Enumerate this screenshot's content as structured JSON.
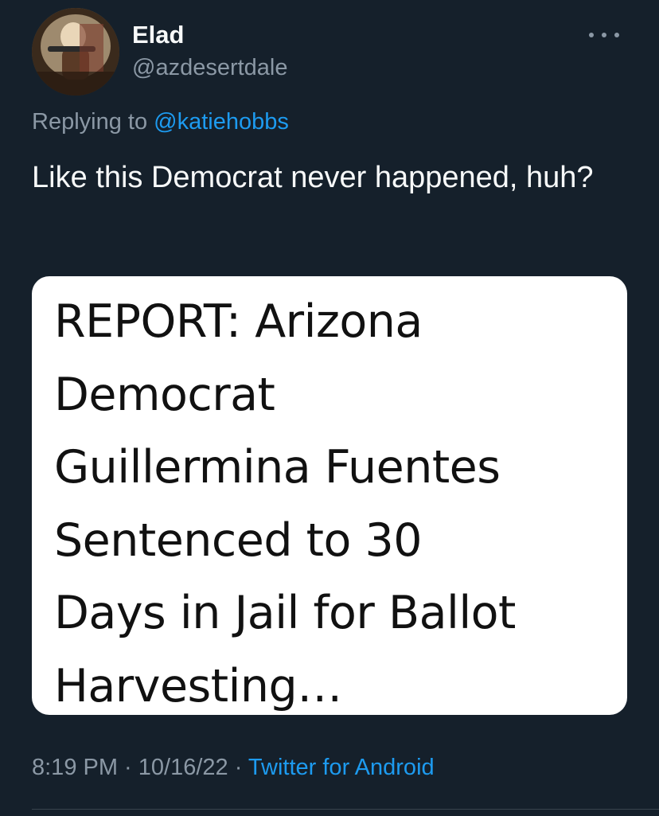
{
  "author": {
    "display_name": "Elad",
    "handle": "@azdesertdale"
  },
  "reply": {
    "prefix": "Replying to ",
    "mention": "@katiehobbs"
  },
  "tweet": {
    "text": "Like this Democrat never happened, huh?"
  },
  "media": {
    "headline": "REPORT: Arizona\nDemocrat\nGuillermina Fuentes\nSentenced to 30\nDays in Jail for Ballot\nHarvesting…"
  },
  "meta": {
    "time": "8:19 PM",
    "sep1": " · ",
    "date": "10/16/22",
    "sep2": " · ",
    "source": "Twitter for Android"
  },
  "icons": {
    "more": "more-horizontal-icon"
  },
  "colors": {
    "background": "#15202b",
    "accent": "#1d9bf0",
    "secondary_text": "#8b98a5",
    "primary_text": "#f7f9f9"
  }
}
